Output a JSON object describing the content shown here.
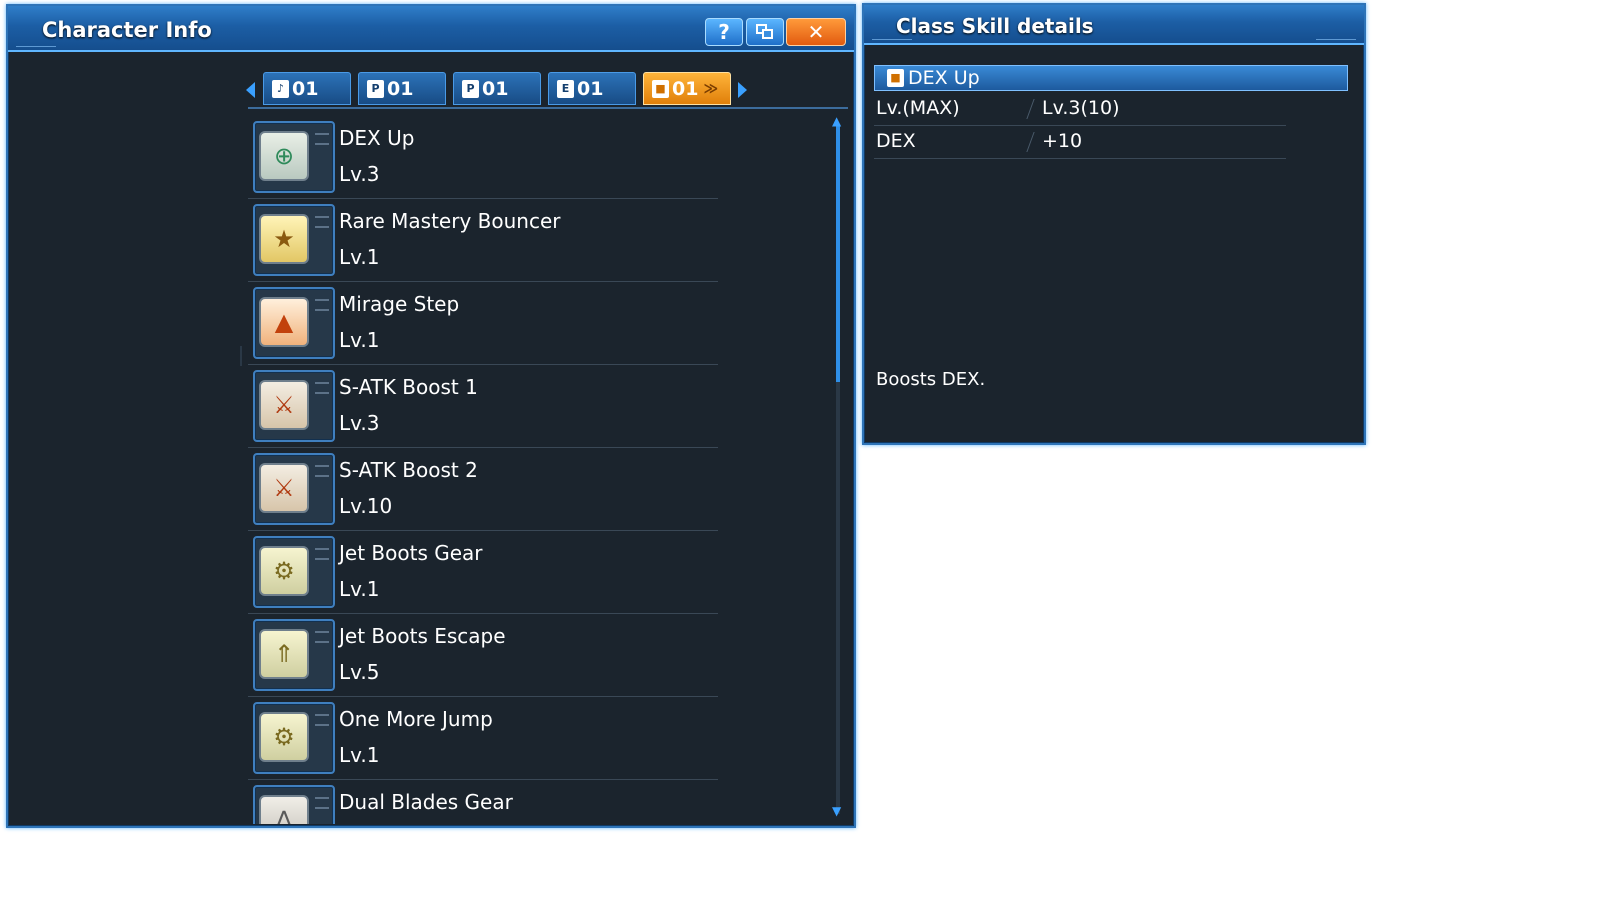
{
  "character_info": {
    "title": "Character Info",
    "help_label": "?",
    "close_label": "✕",
    "tabs": [
      {
        "label": "01",
        "icon": "♪"
      },
      {
        "label": "01",
        "icon": "P"
      },
      {
        "label": "01",
        "icon": "P"
      },
      {
        "label": "01",
        "icon": "E"
      },
      {
        "label": "01",
        "icon": "■",
        "chevron": "≫"
      }
    ],
    "skills": [
      {
        "name": "DEX Up",
        "level": "Lv.3",
        "icon": "dex-up-icon",
        "glyph": "⊕"
      },
      {
        "name": "Rare Mastery Bouncer",
        "level": "Lv.1",
        "icon": "rare-mastery-icon",
        "glyph": "★"
      },
      {
        "name": "Mirage Step",
        "level": "Lv.1",
        "icon": "mirage-step-icon",
        "glyph": "▲"
      },
      {
        "name": "S-ATK Boost 1",
        "level": "Lv.3",
        "icon": "sword-boost-icon",
        "glyph": "⚔"
      },
      {
        "name": "S-ATK Boost 2",
        "level": "Lv.10",
        "icon": "sword-boost-icon",
        "glyph": "⚔"
      },
      {
        "name": "Jet Boots Gear",
        "level": "Lv.1",
        "icon": "jet-boots-gear-icon",
        "glyph": "⚙"
      },
      {
        "name": "Jet Boots Escape",
        "level": "Lv.5",
        "icon": "jet-boots-escape-icon",
        "glyph": "⇑"
      },
      {
        "name": "One More Jump",
        "level": "Lv.1",
        "icon": "one-more-jump-icon",
        "glyph": "⚙"
      },
      {
        "name": "Dual Blades Gear",
        "level": "",
        "icon": "dual-blades-icon",
        "glyph": "⋀"
      }
    ]
  },
  "class_skill_details": {
    "title": "Class Skill details",
    "selected_skill": "DEX Up",
    "rows": [
      {
        "key": "Lv.(MAX)",
        "value": "Lv.3(10)"
      },
      {
        "key": "DEX",
        "value": "+10"
      }
    ],
    "description": "Boosts DEX."
  },
  "colors": {
    "panel_bg": "#1b242d",
    "title_blue": "#1c5ea5",
    "accent_orange": "#e07f0a",
    "border_blue": "#2e74b8"
  }
}
